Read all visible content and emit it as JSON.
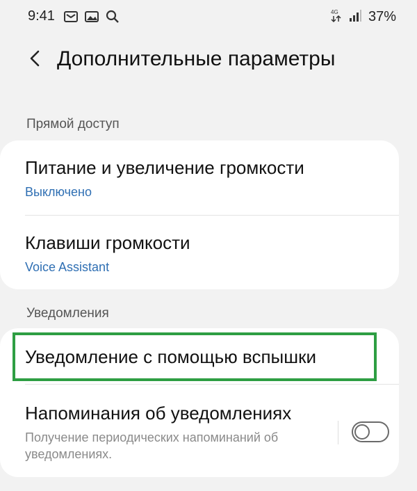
{
  "status_bar": {
    "time": "9:41",
    "battery": "37%",
    "network_label": "4G"
  },
  "header": {
    "title": "Дополнительные параметры"
  },
  "sections": {
    "direct_access": {
      "label": "Прямой доступ",
      "items": [
        {
          "title": "Питание и увеличение громкости",
          "subtitle": "Выключено"
        },
        {
          "title": "Клавиши громкости",
          "subtitle": "Voice Assistant"
        }
      ]
    },
    "notifications": {
      "label": "Уведомления",
      "items": [
        {
          "title": "Уведомление с помощью вспышки"
        },
        {
          "title": "Напоминания об уведомлениях",
          "description": "Получение периодических напоминаний об уведомлениях.",
          "toggle_on": false
        }
      ]
    }
  },
  "colors": {
    "accent_blue": "#2f6fb3",
    "highlight_green": "#2e9e43",
    "background": "#f2f2f2"
  }
}
